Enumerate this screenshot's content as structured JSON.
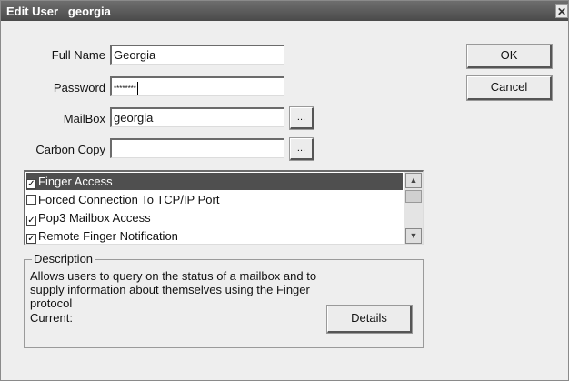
{
  "window": {
    "title": "Edit User   georgia",
    "close_glyph": "✕"
  },
  "form": {
    "full_name_label": "Full Name",
    "full_name_value": "Georgia",
    "password_label": "Password",
    "password_value": "********",
    "mailbox_label": "MailBox",
    "mailbox_value": "georgia",
    "carbon_copy_label": "Carbon Copy",
    "carbon_copy_value": "",
    "browse_label": "..."
  },
  "buttons": {
    "ok": "OK",
    "cancel": "Cancel",
    "details": "Details"
  },
  "permissions": [
    {
      "label": "Finger Access",
      "checked": true,
      "selected": true
    },
    {
      "label": "Forced Connection To TCP/IP Port",
      "checked": false,
      "selected": false
    },
    {
      "label": "Pop3 Mailbox Access",
      "checked": true,
      "selected": false
    },
    {
      "label": "Remote Finger Notification",
      "checked": true,
      "selected": false
    }
  ],
  "scrollbar": {
    "up_icon": "▲",
    "down_icon": "▼"
  },
  "description": {
    "legend": "Description",
    "text": "Allows users to query on the status of a mailbox and to supply information about themselves using the Finger protocol",
    "current_label": "Current:"
  },
  "colors": {
    "selection": "#4f4f4f",
    "titlebar": "#5a5a5a"
  }
}
